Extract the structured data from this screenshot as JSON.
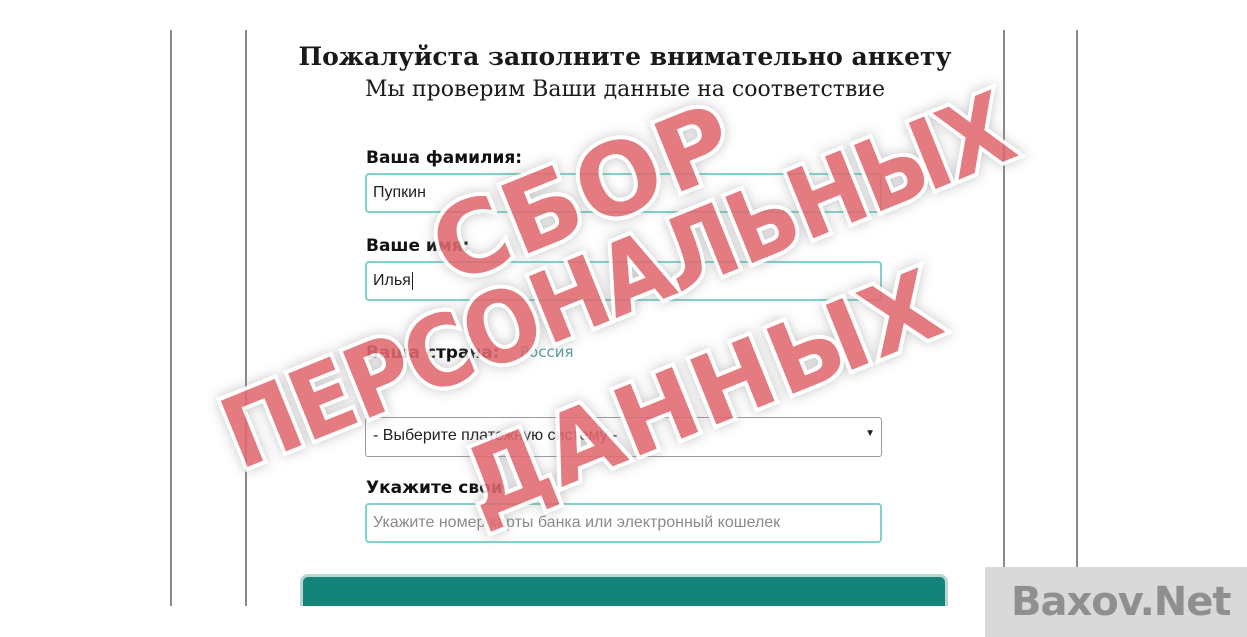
{
  "form": {
    "heading": "Пожалуйста заполните внимательно анкету",
    "subheading": "Мы проверим Ваши данные на соответствие",
    "surname_label": "Ваша фамилия:",
    "surname_value": "Пупкин",
    "name_label": "Ваше имя:",
    "name_value": "Илья",
    "country_label": "Ваша страна:",
    "country_value": "Россия",
    "payment_select_value": "- Выберите платежную систему -",
    "details_label": "Укажите свои",
    "card_placeholder": "Укажите номер карты банка или электронный кошелек"
  },
  "stamp": {
    "line1": "СБОР",
    "line2": "ПЕРСОНАЛЬНЫХ",
    "line3": "ДАННЫХ",
    "color": "#e0696f"
  },
  "watermark": {
    "text": "Baxov.Net"
  },
  "colors": {
    "accent": "#14847a",
    "field_border": "#7fd3c9"
  }
}
